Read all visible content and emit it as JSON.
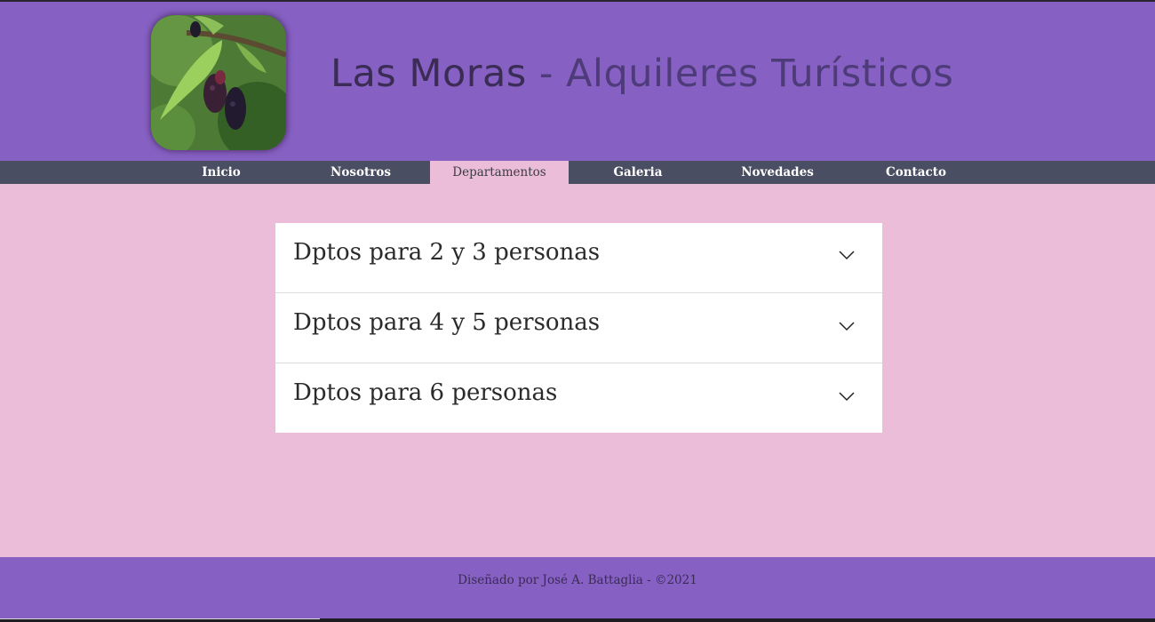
{
  "header": {
    "brand": "Las Moras",
    "separator": " - ",
    "tagline": "Alquileres Turísticos",
    "logo_icon": "mulberry-branch-photo",
    "background_color": "#8660c2"
  },
  "nav": {
    "items": [
      {
        "label": "Inicio",
        "active": false
      },
      {
        "label": "Nosotros",
        "active": false
      },
      {
        "label": "Departamentos",
        "active": true
      },
      {
        "label": "Galeria",
        "active": false
      },
      {
        "label": "Novedades",
        "active": false
      },
      {
        "label": "Contacto",
        "active": false
      }
    ],
    "background_color": "#4a4e63"
  },
  "accordion": {
    "items": [
      {
        "title": "Dptos para 2 y 3 personas",
        "icon": "chevron-down-icon",
        "expanded": false
      },
      {
        "title": "Dptos para 4 y 5 personas",
        "icon": "chevron-down-icon",
        "expanded": false
      },
      {
        "title": "Dptos para 6 personas",
        "icon": "chevron-down-icon",
        "expanded": false
      }
    ]
  },
  "page": {
    "background_color": "#ecbdd8"
  },
  "footer": {
    "text": "Diseñado por José A. Battaglia - ©2021"
  }
}
